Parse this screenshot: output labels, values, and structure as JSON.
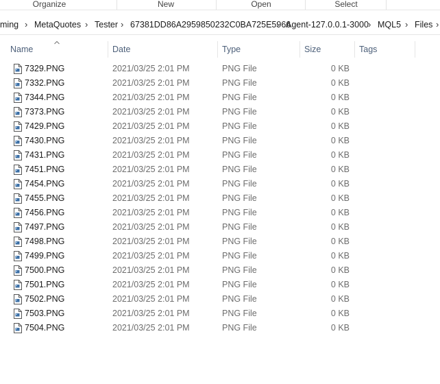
{
  "ribbon": {
    "groups": [
      "Organize",
      "New",
      "Open",
      "Select"
    ]
  },
  "breadcrumb": {
    "segments": [
      "ming",
      "MetaQuotes",
      "Tester",
      "67381DD86A2959850232C0BA725E5966",
      "Agent-127.0.0.1-3000",
      "MQL5",
      "Files"
    ],
    "separator": "›"
  },
  "columns": {
    "name": "Name",
    "date": "Date",
    "type": "Type",
    "size": "Size",
    "tags": "Tags"
  },
  "files": [
    {
      "name": "7329.PNG",
      "date": "2021/03/25 2:01 PM",
      "type": "PNG File",
      "size": "0 KB"
    },
    {
      "name": "7332.PNG",
      "date": "2021/03/25 2:01 PM",
      "type": "PNG File",
      "size": "0 KB"
    },
    {
      "name": "7344.PNG",
      "date": "2021/03/25 2:01 PM",
      "type": "PNG File",
      "size": "0 KB"
    },
    {
      "name": "7373.PNG",
      "date": "2021/03/25 2:01 PM",
      "type": "PNG File",
      "size": "0 KB"
    },
    {
      "name": "7429.PNG",
      "date": "2021/03/25 2:01 PM",
      "type": "PNG File",
      "size": "0 KB"
    },
    {
      "name": "7430.PNG",
      "date": "2021/03/25 2:01 PM",
      "type": "PNG File",
      "size": "0 KB"
    },
    {
      "name": "7431.PNG",
      "date": "2021/03/25 2:01 PM",
      "type": "PNG File",
      "size": "0 KB"
    },
    {
      "name": "7451.PNG",
      "date": "2021/03/25 2:01 PM",
      "type": "PNG File",
      "size": "0 KB"
    },
    {
      "name": "7454.PNG",
      "date": "2021/03/25 2:01 PM",
      "type": "PNG File",
      "size": "0 KB"
    },
    {
      "name": "7455.PNG",
      "date": "2021/03/25 2:01 PM",
      "type": "PNG File",
      "size": "0 KB"
    },
    {
      "name": "7456.PNG",
      "date": "2021/03/25 2:01 PM",
      "type": "PNG File",
      "size": "0 KB"
    },
    {
      "name": "7497.PNG",
      "date": "2021/03/25 2:01 PM",
      "type": "PNG File",
      "size": "0 KB"
    },
    {
      "name": "7498.PNG",
      "date": "2021/03/25 2:01 PM",
      "type": "PNG File",
      "size": "0 KB"
    },
    {
      "name": "7499.PNG",
      "date": "2021/03/25 2:01 PM",
      "type": "PNG File",
      "size": "0 KB"
    },
    {
      "name": "7500.PNG",
      "date": "2021/03/25 2:01 PM",
      "type": "PNG File",
      "size": "0 KB"
    },
    {
      "name": "7501.PNG",
      "date": "2021/03/25 2:01 PM",
      "type": "PNG File",
      "size": "0 KB"
    },
    {
      "name": "7502.PNG",
      "date": "2021/03/25 2:01 PM",
      "type": "PNG File",
      "size": "0 KB"
    },
    {
      "name": "7503.PNG",
      "date": "2021/03/25 2:01 PM",
      "type": "PNG File",
      "size": "0 KB"
    },
    {
      "name": "7504.PNG",
      "date": "2021/03/25 2:01 PM",
      "type": "PNG File",
      "size": "0 KB"
    }
  ],
  "icons": {
    "file": "png-file-icon",
    "sort": "sort-ascending-icon",
    "breadcrumb_separator": "chevron-right-icon"
  },
  "colors": {
    "header_text": "#4c5f79",
    "secondary_text": "#6d6d6d",
    "primary_text": "#1a1a1a"
  }
}
